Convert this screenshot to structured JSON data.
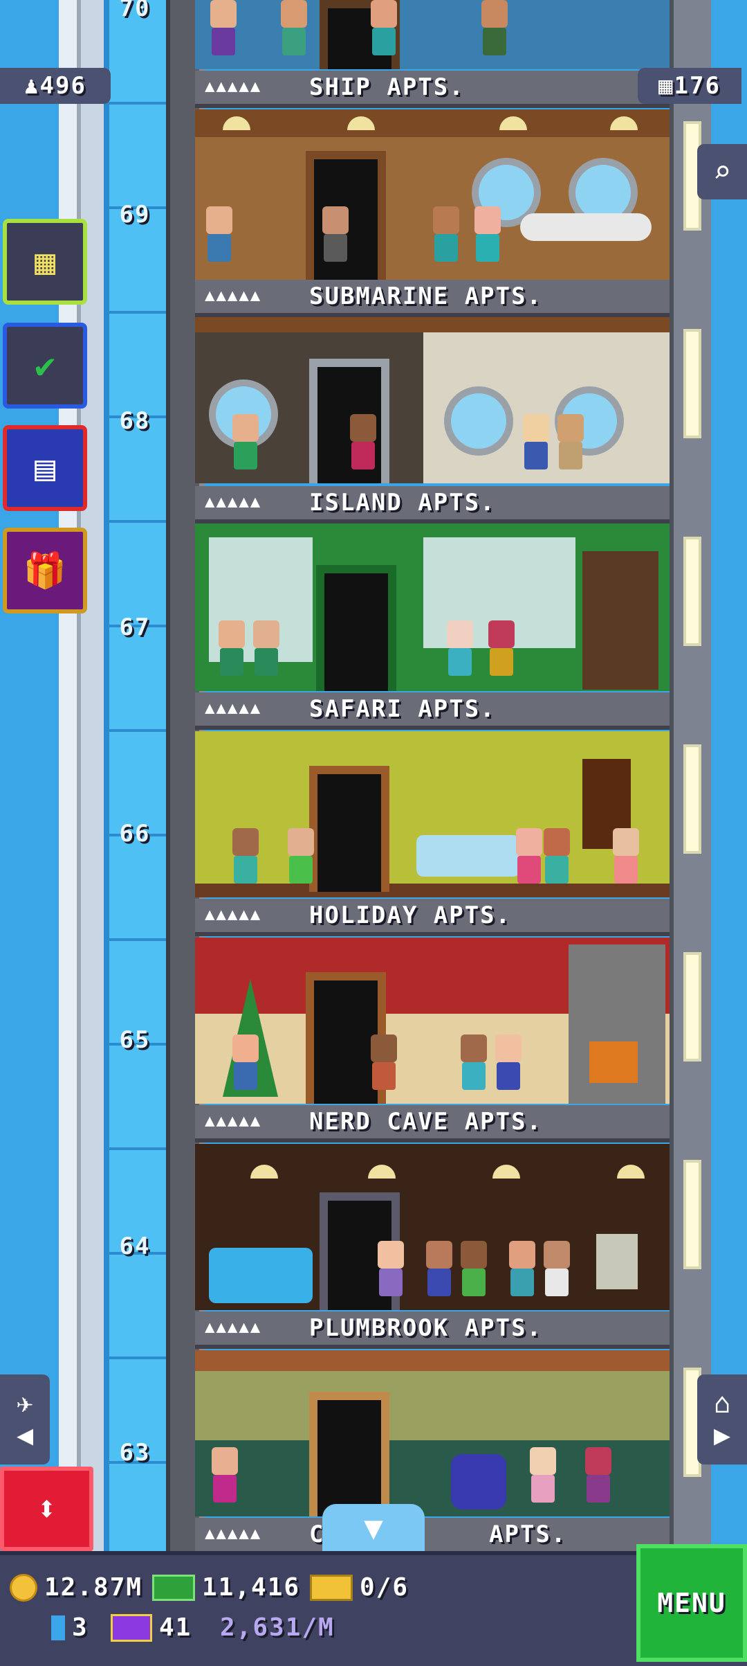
{
  "stats": {
    "population": "496",
    "floor_count": "176"
  },
  "floor_numbers": [
    "70",
    "69",
    "68",
    "67",
    "66",
    "65",
    "64",
    "63"
  ],
  "floors": [
    {
      "name": "SHIP APTS.",
      "stars": "▲▲▲▲▲"
    },
    {
      "name": "SUBMARINE APTS.",
      "stars": "▲▲▲▲▲"
    },
    {
      "name": "ISLAND APTS.",
      "stars": "▲▲▲▲▲"
    },
    {
      "name": "SAFARI APTS.",
      "stars": "▲▲▲▲▲"
    },
    {
      "name": "HOLIDAY APTS.",
      "stars": "▲▲▲▲▲"
    },
    {
      "name": "NERD CAVE APTS.",
      "stars": "▲▲▲▲▲"
    },
    {
      "name": "PLUMBROOK APTS.",
      "stars": "▲▲▲▲▲"
    },
    {
      "name_left": "C",
      "name_right": "APTS.",
      "stars": "▲▲▲▲▲"
    }
  ],
  "side_buttons": [
    {
      "icon": "building-icon"
    },
    {
      "icon": "checklist-icon"
    },
    {
      "icon": "calendar-icon"
    },
    {
      "icon": "gift-icon"
    }
  ],
  "hud": {
    "coins": "12.87M",
    "bux": "11,416",
    "tickets": "0/6",
    "gems": "3",
    "vip": "41",
    "income": "2,631/M",
    "menu_label": "MENU"
  },
  "colors": {
    "sky": "#3aa6e8",
    "hud_bg": "#3f4361",
    "menu_green": "#21b43a",
    "elevator_red": "#e21c34"
  }
}
